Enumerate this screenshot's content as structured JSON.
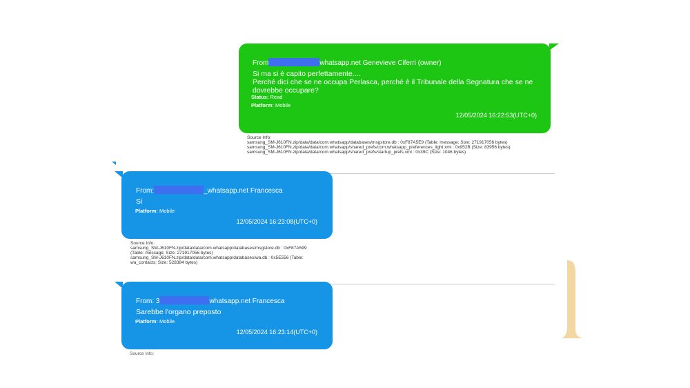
{
  "colors": {
    "green": "#1ec614",
    "blue": "#1694e6",
    "redaction": "#3f6ff0",
    "accent_shape": "#f2d7a4"
  },
  "messages": [
    {
      "from_prefix": "From",
      "from_suffix": "whatsapp.net Genevieve Ciferri (owner)",
      "text": "Si ma si è capito perfettamente....\nPerché dici che se ne occupa Perlasca, perché è il Tribunale della Segnatura che se ne dovrebbe occupare?",
      "status_label": "Status:",
      "status_value": "Read",
      "platform_label": "Platform:",
      "platform_value": "Mobile",
      "timestamp": "12/05/2024 16:22:53(UTC+0)",
      "source_info": [
        "Source Info:",
        "samsung_SM-J610FN.zip/data/data/com.whatsapp/databases/msgstore.db : 0xF87A5E9 (Table: message; Size: 271917056 bytes)",
        "samsung_SM-J610FN.zip/data/data/com.whatsapp/shared_prefs/com.whatsapp_preferences_light.xml : 0x952B (Size: 83956 bytes)",
        "samsung_SM-J610FN.zip/data/data/com.whatsapp/shared_prefs/startup_prefs.xml : 0x39C (Size: 1046 bytes)"
      ]
    },
    {
      "from_prefix": "From:",
      "from_suffix": "_whatsapp.net Francesca",
      "text": "Si",
      "platform_label": "Platform:",
      "platform_value": "Mobile",
      "timestamp": "12/05/2024 16:23:08(UTC+0)",
      "source_info": [
        "Source Info:",
        "samsung_SM-J610FN.zip/data/data/com.whatsapp/databases/msgstore.db : 0xF87A599",
        "(Table: message; Size: 271917056 bytes)",
        "samsung_SM-J610FN.zip/data/data/com.whatsapp/databases/wa.db : 0x5E556 (Table:",
        "wa_contacts; Size: 528384 bytes)"
      ]
    },
    {
      "from_prefix": "From: 3",
      "from_suffix": "whatsapp.net Francesca",
      "text": "Sarebbe l'organo preposto",
      "platform_label": "Platform:",
      "platform_value": "Mobile",
      "timestamp": "12/05/2024 16:23:14(UTC+0)",
      "source_info_cut": "Source Info:"
    }
  ]
}
